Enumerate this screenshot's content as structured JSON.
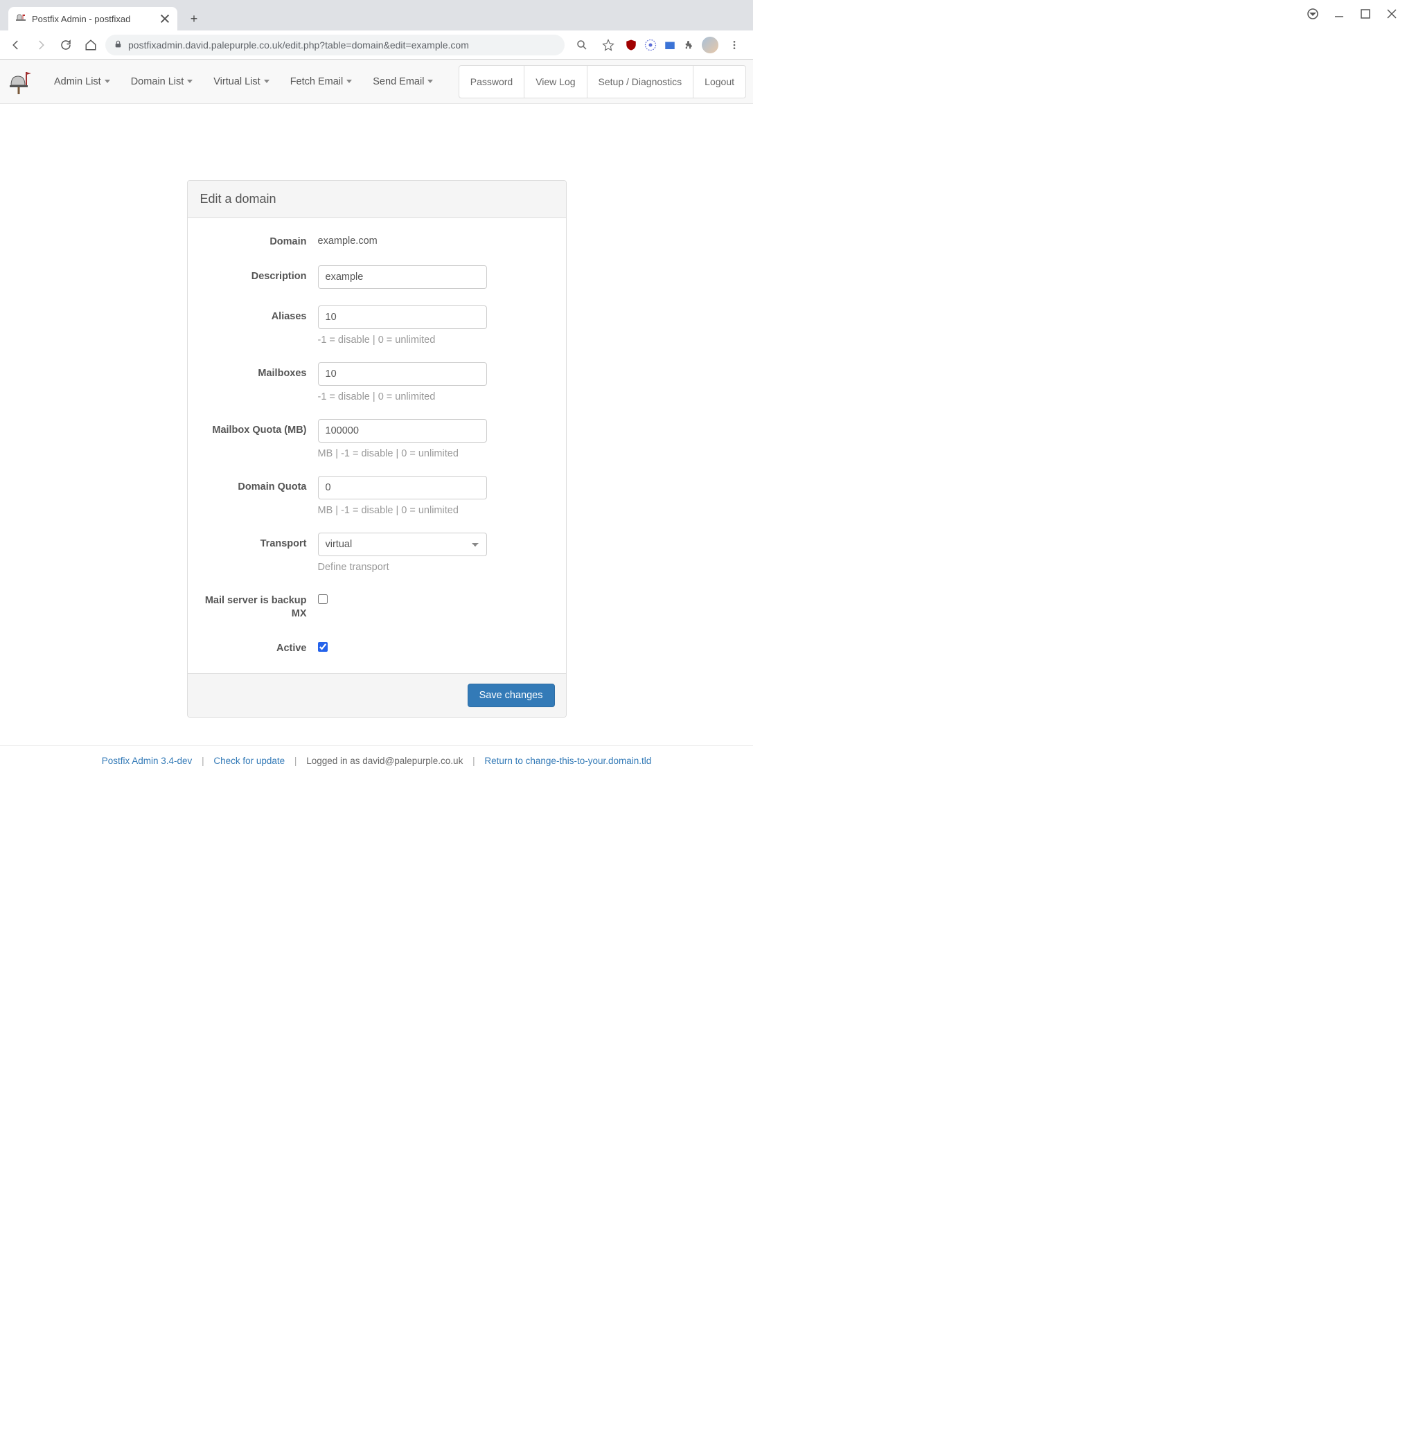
{
  "browser": {
    "tab_title": "Postfix Admin - postfixad",
    "url": "postfixadmin.david.palepurple.co.uk/edit.php?table=domain&edit=example.com"
  },
  "nav": {
    "menu": [
      "Admin List",
      "Domain List",
      "Virtual List",
      "Fetch Email",
      "Send Email"
    ],
    "right": [
      "Password",
      "View Log",
      "Setup / Diagnostics",
      "Logout"
    ]
  },
  "panel": {
    "heading": "Edit a domain",
    "submit": "Save changes"
  },
  "fields": {
    "domain": {
      "label": "Domain",
      "value": "example.com"
    },
    "description": {
      "label": "Description",
      "value": "example"
    },
    "aliases": {
      "label": "Aliases",
      "value": "10",
      "help": "-1 = disable | 0 = unlimited"
    },
    "mailboxes": {
      "label": "Mailboxes",
      "value": "10",
      "help": "-1 = disable | 0 = unlimited"
    },
    "mailbox_quota": {
      "label": "Mailbox Quota (MB)",
      "value": "100000",
      "help": "MB | -1 = disable | 0 = unlimited"
    },
    "domain_quota": {
      "label": "Domain Quota",
      "value": "0",
      "help": "MB | -1 = disable | 0 = unlimited"
    },
    "transport": {
      "label": "Transport",
      "value": "virtual",
      "help": "Define transport"
    },
    "backupmx": {
      "label": "Mail server is backup MX",
      "checked": false
    },
    "active": {
      "label": "Active",
      "checked": true
    }
  },
  "footer": {
    "product": "Postfix Admin 3.4-dev",
    "check_update": "Check for update",
    "logged_in": "Logged in as david@palepurple.co.uk",
    "return_link": "Return to change-this-to-your.domain.tld"
  }
}
